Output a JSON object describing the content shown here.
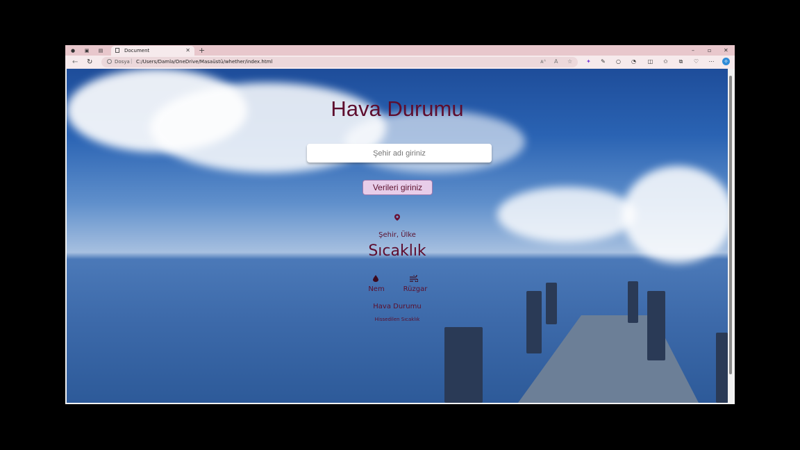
{
  "browser": {
    "tab_title": "Document",
    "address_label": "Dosya",
    "url": "C:/Users/Damla/OneDrive/Masaüstü/whether/index.html"
  },
  "app": {
    "heading": "Hava Durumu",
    "search_placeholder": "Şehir adı giriniz",
    "submit_label": "Verileri giriniz",
    "location": "Şehir, Ülke",
    "temperature": "Sıcaklık",
    "humidity_label": "Nem",
    "wind_label": "Rüzgar",
    "condition": "Hava Durumu",
    "feels_like": "Hissedilen Sıcaklık"
  },
  "icons": [
    "profile-icon",
    "tab-group-icon",
    "tab-actions-icon",
    "document-icon",
    "close-icon",
    "plus-icon",
    "back-icon",
    "refresh-icon",
    "info-icon",
    "read-aloud-icon",
    "text-icon",
    "star-icon",
    "extension-icon",
    "pen-icon",
    "circle-icon",
    "browser-essentials-icon",
    "split-icon",
    "favorites-icon",
    "collections-icon",
    "shopping-icon",
    "more-icon",
    "copilot-icon",
    "map-pin-icon",
    "water-drop-icon",
    "wind-icon"
  ],
  "colors": {
    "accent": "#5e0d2e",
    "button_bg": "#e8cde9",
    "chrome": "#e8c7cc"
  }
}
